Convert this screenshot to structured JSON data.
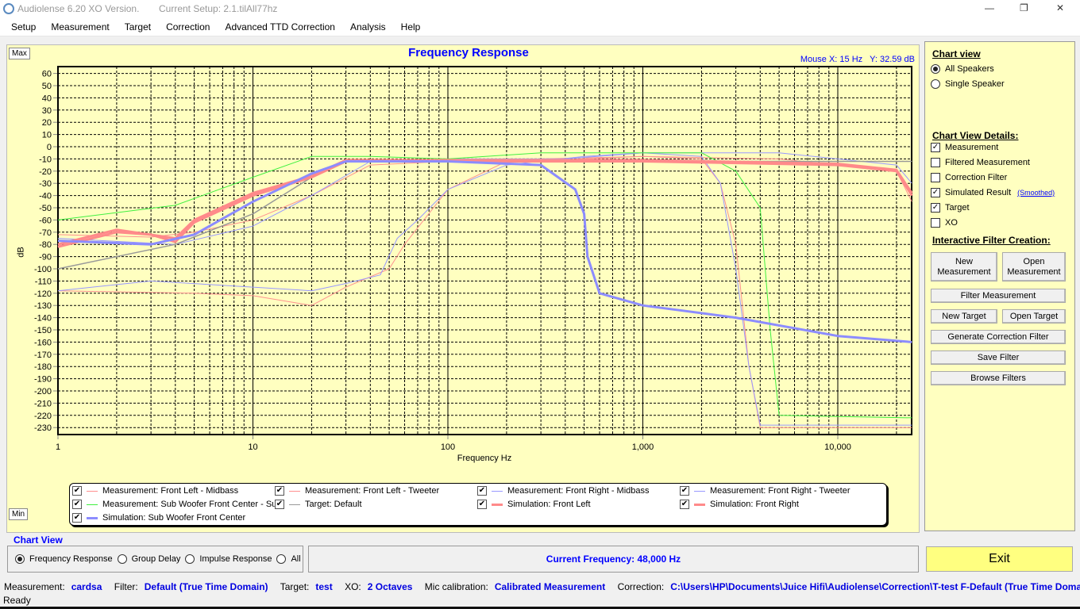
{
  "window": {
    "app_title": "Audiolense 6.20 XO Version.",
    "setup": "Current Setup: 2.1.tilAll77hz",
    "min": "—",
    "max": "❐",
    "close": "✕"
  },
  "menu": [
    "Setup",
    "Measurement",
    "Target",
    "Correction",
    "Advanced TTD Correction",
    "Analysis",
    "Help"
  ],
  "chart": {
    "max_btn": "Max",
    "min_btn": "Min",
    "mouse_readout": "Mouse X: 15 Hz   Y: 32.59 dB"
  },
  "chart_data": {
    "type": "line",
    "title": "Frequency Response",
    "xlabel": "Frequency Hz",
    "ylabel": "dB",
    "xscale": "log",
    "xlim": [
      1,
      24000
    ],
    "ylim": [
      -230,
      60
    ],
    "xticks": [
      1,
      10,
      100,
      1000,
      10000
    ],
    "xtick_labels": [
      "1",
      "10",
      "100",
      "1,000",
      "10,000"
    ],
    "yticks": [
      60,
      50,
      40,
      30,
      20,
      10,
      0,
      -10,
      -20,
      -30,
      -40,
      -50,
      -60,
      -70,
      -80,
      -90,
      -100,
      -110,
      -120,
      -130,
      -140,
      -150,
      -160,
      -170,
      -180,
      -190,
      -200,
      -210,
      -220,
      -230
    ],
    "grid": true,
    "series": [
      {
        "name": "Measurement: Front Left - Midbass",
        "color": "#ff9090",
        "width": 1,
        "points": [
          [
            1,
            -72
          ],
          [
            3,
            -74
          ],
          [
            5,
            -70
          ],
          [
            10,
            -60
          ],
          [
            20,
            -40
          ],
          [
            40,
            -15
          ],
          [
            100,
            -12
          ],
          [
            300,
            -10
          ],
          [
            1000,
            -8
          ],
          [
            2000,
            -10
          ],
          [
            2500,
            -30
          ],
          [
            3000,
            -80
          ],
          [
            3500,
            -180
          ],
          [
            4000,
            -230
          ],
          [
            24000,
            -230
          ]
        ]
      },
      {
        "name": "Measurement: Front Left - Tweeter",
        "color": "#ff9090",
        "width": 1,
        "points": [
          [
            1,
            -118
          ],
          [
            5,
            -120
          ],
          [
            10,
            -122
          ],
          [
            20,
            -130
          ],
          [
            30,
            -115
          ],
          [
            50,
            -100
          ],
          [
            60,
            -80
          ],
          [
            100,
            -35
          ],
          [
            200,
            -12
          ],
          [
            500,
            -10
          ],
          [
            1000,
            -8
          ],
          [
            5000,
            -10
          ],
          [
            10000,
            -15
          ],
          [
            20000,
            -20
          ],
          [
            24000,
            -45
          ]
        ]
      },
      {
        "name": "Measurement: Front Right - Midbass",
        "color": "#9898ff",
        "width": 1,
        "points": [
          [
            1,
            -75
          ],
          [
            4,
            -80
          ],
          [
            10,
            -65
          ],
          [
            20,
            -40
          ],
          [
            40,
            -12
          ],
          [
            100,
            -10
          ],
          [
            400,
            -10
          ],
          [
            1000,
            -5
          ],
          [
            2000,
            -8
          ],
          [
            2500,
            -30
          ],
          [
            3000,
            -100
          ],
          [
            3500,
            -180
          ],
          [
            4000,
            -228
          ],
          [
            24000,
            -228
          ]
        ]
      },
      {
        "name": "Measurement: Front Right - Tweeter",
        "color": "#9898ff",
        "width": 1,
        "points": [
          [
            1,
            -118
          ],
          [
            3,
            -110
          ],
          [
            10,
            -115
          ],
          [
            20,
            -118
          ],
          [
            30,
            -112
          ],
          [
            45,
            -105
          ],
          [
            55,
            -75
          ],
          [
            70,
            -60
          ],
          [
            100,
            -35
          ],
          [
            200,
            -15
          ],
          [
            500,
            -8
          ],
          [
            1000,
            -5
          ],
          [
            5000,
            -5
          ],
          [
            10000,
            -10
          ],
          [
            20000,
            -15
          ],
          [
            24000,
            -30
          ]
        ]
      },
      {
        "name": "Measurement: Sub Woofer Front Center - Sub",
        "color": "#40f040",
        "width": 1,
        "points": [
          [
            1,
            -60
          ],
          [
            4,
            -48
          ],
          [
            10,
            -25
          ],
          [
            20,
            -8
          ],
          [
            40,
            -8
          ],
          [
            100,
            -10
          ],
          [
            300,
            -5
          ],
          [
            1000,
            -5
          ],
          [
            2000,
            -5
          ],
          [
            3000,
            -20
          ],
          [
            4000,
            -50
          ],
          [
            4500,
            -150
          ],
          [
            5000,
            -220
          ],
          [
            24000,
            -222
          ]
        ]
      },
      {
        "name": "Target: Default",
        "color": "#999999",
        "width": 1.5,
        "points": [
          [
            1,
            -100
          ],
          [
            4,
            -80
          ],
          [
            10,
            -55
          ],
          [
            20,
            -25
          ],
          [
            30,
            -12
          ],
          [
            24000,
            -12
          ]
        ]
      },
      {
        "name": "Simulation: Front Left",
        "color": "#ff8a8a",
        "width": 3,
        "points": [
          [
            1,
            -82
          ],
          [
            2,
            -70
          ],
          [
            3,
            -72
          ],
          [
            4,
            -78
          ],
          [
            5,
            -62
          ],
          [
            10,
            -40
          ],
          [
            20,
            -25
          ],
          [
            30,
            -12
          ],
          [
            100,
            -12
          ],
          [
            1000,
            -12
          ],
          [
            5000,
            -14
          ],
          [
            10000,
            -15
          ],
          [
            20000,
            -20
          ],
          [
            24000,
            -40
          ]
        ]
      },
      {
        "name": "Simulation: Front Right",
        "color": "#ff8a8a",
        "width": 3,
        "points": [
          [
            1,
            -80
          ],
          [
            2,
            -68
          ],
          [
            4,
            -75
          ],
          [
            5,
            -60
          ],
          [
            10,
            -38
          ],
          [
            20,
            -24
          ],
          [
            30,
            -11
          ],
          [
            100,
            -11
          ],
          [
            1000,
            -11
          ],
          [
            5000,
            -13
          ],
          [
            10000,
            -14
          ],
          [
            20000,
            -19
          ],
          [
            24000,
            -38
          ]
        ]
      },
      {
        "name": "Simulation: Sub Woofer Front Center",
        "color": "#8c8cff",
        "width": 3,
        "points": [
          [
            1,
            -77
          ],
          [
            3,
            -80
          ],
          [
            5,
            -72
          ],
          [
            10,
            -45
          ],
          [
            20,
            -22
          ],
          [
            30,
            -12
          ],
          [
            100,
            -12
          ],
          [
            300,
            -15
          ],
          [
            450,
            -35
          ],
          [
            500,
            -55
          ],
          [
            520,
            -90
          ],
          [
            600,
            -120
          ],
          [
            1000,
            -130
          ],
          [
            3000,
            -140
          ],
          [
            10000,
            -155
          ],
          [
            24000,
            -160
          ]
        ]
      }
    ]
  },
  "legend": [
    {
      "label": "Measurement: Front Left - Midbass",
      "checked": true
    },
    {
      "label": "Measurement: Front Left - Tweeter",
      "checked": true
    },
    {
      "label": "Measurement: Front Right - Midbass",
      "checked": true
    },
    {
      "label": "Measurement: Front Right - Tweeter",
      "checked": true
    },
    {
      "label": "Measurement: Sub Woofer Front Center - Sub",
      "checked": true
    },
    {
      "label": "Target: Default",
      "checked": true
    },
    {
      "label": "Simulation: Front Left",
      "checked": true
    },
    {
      "label": "Simulation: Front Right",
      "checked": true
    },
    {
      "label": "Simulation: Sub Woofer Front Center",
      "checked": true
    }
  ],
  "right": {
    "chart_view_title": "Chart view",
    "views": [
      {
        "label": "All Speakers",
        "on": true
      },
      {
        "label": "Single Speaker",
        "on": false
      }
    ],
    "details_title": "Chart View Details:",
    "details": [
      {
        "label": "Measurement",
        "checked": true
      },
      {
        "label": "Filtered Measurement",
        "checked": false
      },
      {
        "label": "Correction Filter",
        "checked": false
      },
      {
        "label": "Simulated Result",
        "checked": true
      },
      {
        "label": "Target",
        "checked": true
      },
      {
        "label": "XO",
        "checked": false
      }
    ],
    "smoothed": "(Smoothed)",
    "ifc_title": "Interactive Filter Creation:",
    "buttons": {
      "new_meas": "New Measurement",
      "open_meas": "Open Measurement",
      "filter_meas": "Filter Measurement",
      "new_target": "New Target",
      "open_target": "Open Target",
      "gen": "Generate Correction Filter",
      "save": "Save Filter",
      "browse": "Browse Filters"
    }
  },
  "bottom": {
    "chart_view_label": "Chart View",
    "views": [
      {
        "label": "Frequency Response",
        "on": true
      },
      {
        "label": "Group Delay",
        "on": false
      },
      {
        "label": "Impulse Response",
        "on": false
      },
      {
        "label": "All",
        "on": false
      }
    ],
    "current_frequency": "Current Frequency: 48,000 Hz",
    "exit": "Exit"
  },
  "status": {
    "measurement_label": "Measurement:",
    "measurement": "cardsa",
    "filter_label": "Filter:",
    "filter": "Default (True Time Domain)",
    "target_label": "Target:",
    "target": "test",
    "xo_label": "XO:",
    "xo": "2 Octaves",
    "mic_label": "Mic calibration:",
    "mic": "Calibrated Measurement",
    "correction_label": "Correction:",
    "correction": "C:\\Users\\HP\\Documents\\Juice Hifi\\Audiolense\\Correction\\T-test F-Default (True Time Domain) I",
    "ready": "Ready"
  }
}
